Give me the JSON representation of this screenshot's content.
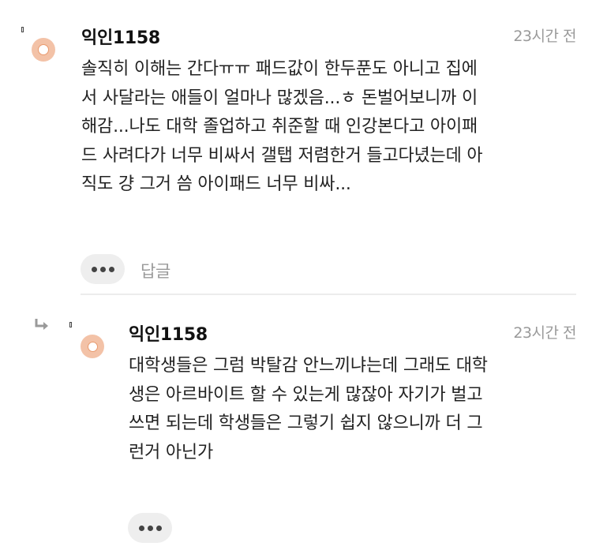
{
  "comments": [
    {
      "author": "익인1158",
      "time": "23시간 전",
      "body_lines": [
        "솔직히 이해는 간다ㅠㅠ 패드값이 한두푼도 아니고 집에",
        "서 사달라는 애들이 얼마나 많겠음...ㅎ 돈벌어보니까 이",
        "해감...나도 대학 졸업하고 취준할 때 인강본다고 아이패",
        "드 사려다가 너무 비싸서 갤탭 저렴한거 들고다녔는데 아",
        "직도 걍 그거 씀 아이패드 너무 비싸..."
      ],
      "reply_label": "답글",
      "more_icon": "ellipsis-icon"
    },
    {
      "author": "익인1158",
      "time": "23시간 전",
      "body_lines": [
        "대학생들은 그럼 박탈감 안느끼냐는데 그래도 대학",
        "생은 아르바이트 할 수 있는게 많잖아 자기가 벌고",
        "쓰면 되는데 학생들은 그렇기 쉽지 않으니까 더 그",
        "런거 아닌가"
      ],
      "is_reply": true,
      "reply_icon": "reply-arrow-icon",
      "more_icon": "ellipsis-icon"
    }
  ],
  "colors": {
    "avatar": "#f3c2a7",
    "muted_text": "#9a9a9a",
    "button_bg": "#eeeeee"
  }
}
